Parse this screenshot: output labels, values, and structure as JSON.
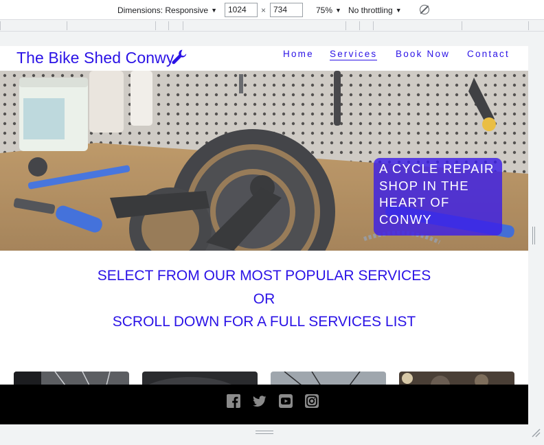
{
  "devtools": {
    "dimensions_label": "Dimensions: Responsive",
    "width_value": "1024",
    "height_value": "734",
    "zoom_label": "75%",
    "throttling_label": "No throttling",
    "times_symbol": "×"
  },
  "site": {
    "logo_text": "The Bike Shed Conwy",
    "nav": [
      "Home",
      "Services",
      "Book Now",
      "Contact"
    ],
    "active_nav": "Services",
    "hero_callout": "A CYCLE REPAIR SHOP IN THE HEART OF CONWY",
    "services_heading": [
      "SELECT FROM OUR MOST POPULAR SERVICES",
      "OR",
      "SCROLL DOWN FOR A FULL SERVICES LIST"
    ],
    "social": [
      "facebook-icon",
      "twitter-icon",
      "youtube-icon",
      "instagram-icon"
    ]
  },
  "colors": {
    "brand_blue": "#2a12e6",
    "callout_bg": "#3c1ee6",
    "footer_bg": "#000000"
  }
}
